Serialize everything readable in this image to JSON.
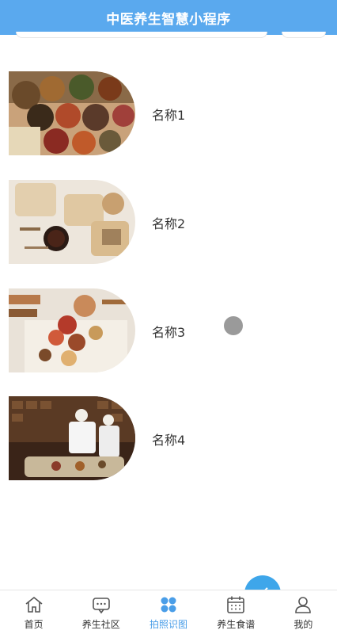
{
  "header": {
    "title": "中医养生智慧小程序"
  },
  "items": [
    {
      "name": "名称1",
      "image": "herbal-ingredients-photo"
    },
    {
      "name": "名称2",
      "image": "herbal-packets-photo"
    },
    {
      "name": "名称3",
      "image": "herbs-on-book-photo"
    },
    {
      "name": "名称4",
      "image": "pharmacy-staff-photo"
    }
  ],
  "tabbar": {
    "tabs": [
      {
        "label": "首页",
        "icon": "home-icon"
      },
      {
        "label": "养生社区",
        "icon": "chat-icon"
      },
      {
        "label": "拍照识图",
        "icon": "grid-icon"
      },
      {
        "label": "养生食谱",
        "icon": "calendar-icon"
      },
      {
        "label": "我的",
        "icon": "user-icon"
      }
    ],
    "active_index": 2
  },
  "colors": {
    "header_bg": "#5aa9ee",
    "active_tab": "#4a9ee8",
    "fab": "#3ea6ea"
  }
}
